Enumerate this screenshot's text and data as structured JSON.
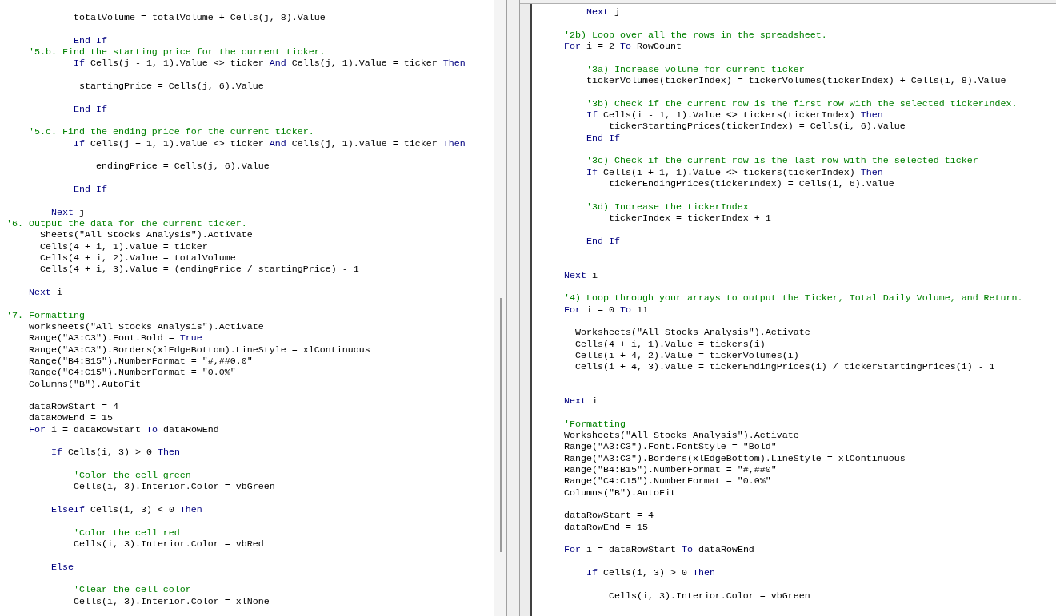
{
  "left_pane": {
    "lines": [
      {
        "tokens": [
          {
            "kind": "plain",
            "text": "            totalVolume = totalVolume + Cells(j, 8).Value"
          }
        ]
      },
      {
        "gap_before": true,
        "tokens": [
          {
            "kind": "keyword",
            "text": "            End If"
          }
        ]
      },
      {
        "tokens": [
          {
            "kind": "comment",
            "text": "    '5.b. Find the starting price for the current ticker."
          }
        ]
      },
      {
        "tokens": [
          {
            "kind": "keyword",
            "text": "            If"
          },
          {
            "kind": "plain",
            "text": " Cells(j - 1, 1).Value <> ticker "
          },
          {
            "kind": "keyword",
            "text": "And"
          },
          {
            "kind": "plain",
            "text": " Cells(j, 1).Value = ticker "
          },
          {
            "kind": "keyword",
            "text": "Then"
          }
        ]
      },
      {
        "gap_before": true,
        "tokens": [
          {
            "kind": "plain",
            "text": "             startingPrice = Cells(j, 6).Value"
          }
        ]
      },
      {
        "gap_before": true,
        "tokens": [
          {
            "kind": "keyword",
            "text": "            End If"
          }
        ]
      },
      {
        "gap_before": true,
        "tokens": [
          {
            "kind": "comment",
            "text": "    '5.c. Find the ending price for the current ticker."
          }
        ]
      },
      {
        "tokens": [
          {
            "kind": "keyword",
            "text": "            If"
          },
          {
            "kind": "plain",
            "text": " Cells(j + 1, 1).Value <> ticker "
          },
          {
            "kind": "keyword",
            "text": "And"
          },
          {
            "kind": "plain",
            "text": " Cells(j, 1).Value = ticker "
          },
          {
            "kind": "keyword",
            "text": "Then"
          }
        ]
      },
      {
        "gap_before": true,
        "tokens": [
          {
            "kind": "plain",
            "text": "                endingPrice = Cells(j, 6).Value"
          }
        ]
      },
      {
        "gap_before": true,
        "tokens": [
          {
            "kind": "keyword",
            "text": "            End If"
          }
        ]
      },
      {
        "gap_before": true,
        "tokens": [
          {
            "kind": "keyword",
            "text": "        Next"
          },
          {
            "kind": "plain",
            "text": " j"
          }
        ]
      },
      {
        "tokens": [
          {
            "kind": "comment",
            "text": "'6. Output the data for the current ticker."
          }
        ]
      },
      {
        "tokens": [
          {
            "kind": "plain",
            "text": "      Sheets(\"All Stocks Analysis\").Activate"
          }
        ]
      },
      {
        "tokens": [
          {
            "kind": "plain",
            "text": "      Cells(4 + i, 1).Value = ticker"
          }
        ]
      },
      {
        "tokens": [
          {
            "kind": "plain",
            "text": "      Cells(4 + i, 2).Value = totalVolume"
          }
        ]
      },
      {
        "tokens": [
          {
            "kind": "plain",
            "text": "      Cells(4 + i, 3).Value = (endingPrice / startingPrice) - 1"
          }
        ]
      },
      {
        "gap_before": true,
        "tokens": [
          {
            "kind": "keyword",
            "text": "    Next"
          },
          {
            "kind": "plain",
            "text": " i"
          }
        ]
      },
      {
        "gap_before": true,
        "tokens": [
          {
            "kind": "comment",
            "text": "'7. Formatting"
          }
        ]
      },
      {
        "tokens": [
          {
            "kind": "plain",
            "text": "    Worksheets(\"All Stocks Analysis\").Activate"
          }
        ]
      },
      {
        "tokens": [
          {
            "kind": "plain",
            "text": "    Range(\"A3:C3\").Font.Bold = "
          },
          {
            "kind": "keyword",
            "text": "True"
          }
        ]
      },
      {
        "tokens": [
          {
            "kind": "plain",
            "text": "    Range(\"A3:C3\").Borders(xlEdgeBottom).LineStyle = xlContinuous"
          }
        ]
      },
      {
        "tokens": [
          {
            "kind": "plain",
            "text": "    Range(\"B4:B15\").NumberFormat = \"#,##0.0\""
          }
        ]
      },
      {
        "tokens": [
          {
            "kind": "plain",
            "text": "    Range(\"C4:C15\").NumberFormat = \"0.0%\""
          }
        ]
      },
      {
        "tokens": [
          {
            "kind": "plain",
            "text": "    Columns(\"B\").AutoFit"
          }
        ]
      },
      {
        "gap_before": true,
        "tokens": [
          {
            "kind": "plain",
            "text": "    dataRowStart = 4"
          }
        ]
      },
      {
        "tokens": [
          {
            "kind": "plain",
            "text": "    dataRowEnd = 15"
          }
        ]
      },
      {
        "tokens": [
          {
            "kind": "keyword",
            "text": "    For"
          },
          {
            "kind": "plain",
            "text": " i = dataRowStart "
          },
          {
            "kind": "keyword",
            "text": "To"
          },
          {
            "kind": "plain",
            "text": " dataRowEnd"
          }
        ]
      },
      {
        "gap_before": true,
        "tokens": [
          {
            "kind": "keyword",
            "text": "        If"
          },
          {
            "kind": "plain",
            "text": " Cells(i, 3) > 0 "
          },
          {
            "kind": "keyword",
            "text": "Then"
          }
        ]
      },
      {
        "gap_before": true,
        "tokens": [
          {
            "kind": "comment",
            "text": "            'Color the cell green"
          }
        ]
      },
      {
        "tokens": [
          {
            "kind": "plain",
            "text": "            Cells(i, 3).Interior.Color = vbGreen"
          }
        ]
      },
      {
        "gap_before": true,
        "tokens": [
          {
            "kind": "keyword",
            "text": "        ElseIf"
          },
          {
            "kind": "plain",
            "text": " Cells(i, 3) < 0 "
          },
          {
            "kind": "keyword",
            "text": "Then"
          }
        ]
      },
      {
        "gap_before": true,
        "tokens": [
          {
            "kind": "comment",
            "text": "            'Color the cell red"
          }
        ]
      },
      {
        "tokens": [
          {
            "kind": "plain",
            "text": "            Cells(i, 3).Interior.Color = vbRed"
          }
        ]
      },
      {
        "gap_before": true,
        "tokens": [
          {
            "kind": "keyword",
            "text": "        Else"
          }
        ]
      },
      {
        "gap_before": true,
        "tokens": [
          {
            "kind": "comment",
            "text": "            'Clear the cell color"
          }
        ]
      },
      {
        "tokens": [
          {
            "kind": "plain",
            "text": "            Cells(i, 3).Interior.Color = xlNone"
          }
        ]
      }
    ]
  },
  "right_pane": {
    "lines": [
      {
        "tokens": [
          {
            "kind": "keyword",
            "text": "    Next"
          },
          {
            "kind": "plain",
            "text": " j"
          }
        ]
      },
      {
        "gap_before": true,
        "tokens": [
          {
            "kind": "comment",
            "text": "'2b) Loop over all the rows in the spreadsheet."
          }
        ]
      },
      {
        "tokens": [
          {
            "kind": "keyword",
            "text": "For"
          },
          {
            "kind": "plain",
            "text": " i = 2 "
          },
          {
            "kind": "keyword",
            "text": "To"
          },
          {
            "kind": "plain",
            "text": " RowCount"
          }
        ]
      },
      {
        "gap_before": true,
        "tokens": [
          {
            "kind": "comment",
            "text": "    '3a) Increase volume for current ticker"
          }
        ]
      },
      {
        "tokens": [
          {
            "kind": "plain",
            "text": "    tickerVolumes(tickerIndex) = tickerVolumes(tickerIndex) + Cells(i, 8).Value"
          }
        ]
      },
      {
        "gap_before": true,
        "tokens": [
          {
            "kind": "comment",
            "text": "    '3b) Check if the current row is the first row with the selected tickerIndex."
          }
        ]
      },
      {
        "tokens": [
          {
            "kind": "keyword",
            "text": "    If"
          },
          {
            "kind": "plain",
            "text": " Cells(i - 1, 1).Value <> tickers(tickerIndex) "
          },
          {
            "kind": "keyword",
            "text": "Then"
          }
        ]
      },
      {
        "tokens": [
          {
            "kind": "plain",
            "text": "        tickerStartingPrices(tickerIndex) = Cells(i, 6).Value"
          }
        ]
      },
      {
        "tokens": [
          {
            "kind": "keyword",
            "text": "    End If"
          }
        ]
      },
      {
        "gap_before": true,
        "tokens": [
          {
            "kind": "comment",
            "text": "    '3c) Check if the current row is the last row with the selected ticker"
          }
        ]
      },
      {
        "tokens": [
          {
            "kind": "keyword",
            "text": "    If"
          },
          {
            "kind": "plain",
            "text": " Cells(i + 1, 1).Value <> tickers(tickerIndex) "
          },
          {
            "kind": "keyword",
            "text": "Then"
          }
        ]
      },
      {
        "tokens": [
          {
            "kind": "plain",
            "text": "        tickerEndingPrices(tickerIndex) = Cells(i, 6).Value"
          }
        ]
      },
      {
        "gap_before": true,
        "tokens": [
          {
            "kind": "comment",
            "text": "    '3d) Increase the tickerIndex"
          }
        ]
      },
      {
        "tokens": [
          {
            "kind": "plain",
            "text": "        tickerIndex = tickerIndex + 1"
          }
        ]
      },
      {
        "gap_before": true,
        "tokens": [
          {
            "kind": "keyword",
            "text": "    End If"
          }
        ]
      },
      {
        "gap_before": true,
        "double_gap": true,
        "tokens": [
          {
            "kind": "keyword",
            "text": "Next"
          },
          {
            "kind": "plain",
            "text": " i"
          }
        ]
      },
      {
        "gap_before": true,
        "tokens": [
          {
            "kind": "comment",
            "text": "'4) Loop through your arrays to output the Ticker, Total Daily Volume, and Return."
          }
        ]
      },
      {
        "tokens": [
          {
            "kind": "keyword",
            "text": "For"
          },
          {
            "kind": "plain",
            "text": " i = 0 "
          },
          {
            "kind": "keyword",
            "text": "To"
          },
          {
            "kind": "plain",
            "text": " 11"
          }
        ]
      },
      {
        "gap_before": true,
        "tokens": [
          {
            "kind": "plain",
            "text": "  Worksheets(\"All Stocks Analysis\").Activate"
          }
        ]
      },
      {
        "tokens": [
          {
            "kind": "plain",
            "text": "  Cells(4 + i, 1).Value = tickers(i)"
          }
        ]
      },
      {
        "tokens": [
          {
            "kind": "plain",
            "text": "  Cells(i + 4, 2).Value = tickerVolumes(i)"
          }
        ]
      },
      {
        "tokens": [
          {
            "kind": "plain",
            "text": "  Cells(i + 4, 3).Value = tickerEndingPrices(i) / tickerStartingPrices(i) - 1"
          }
        ]
      },
      {
        "gap_before": true,
        "double_gap": true,
        "tokens": [
          {
            "kind": "keyword",
            "text": "Next"
          },
          {
            "kind": "plain",
            "text": " i"
          }
        ]
      },
      {
        "gap_before": true,
        "tokens": [
          {
            "kind": "comment",
            "text": "'Formatting"
          }
        ]
      },
      {
        "tokens": [
          {
            "kind": "plain",
            "text": "Worksheets(\"All Stocks Analysis\").Activate"
          }
        ]
      },
      {
        "tokens": [
          {
            "kind": "plain",
            "text": "Range(\"A3:C3\").Font.FontStyle = \"Bold\""
          }
        ]
      },
      {
        "tokens": [
          {
            "kind": "plain",
            "text": "Range(\"A3:C3\").Borders(xlEdgeBottom).LineStyle = xlContinuous"
          }
        ]
      },
      {
        "tokens": [
          {
            "kind": "plain",
            "text": "Range(\"B4:B15\").NumberFormat = \"#,##0\""
          }
        ]
      },
      {
        "tokens": [
          {
            "kind": "plain",
            "text": "Range(\"C4:C15\").NumberFormat = \"0.0%\""
          }
        ]
      },
      {
        "tokens": [
          {
            "kind": "plain",
            "text": "Columns(\"B\").AutoFit"
          }
        ]
      },
      {
        "gap_before": true,
        "tokens": [
          {
            "kind": "plain",
            "text": "dataRowStart = 4"
          }
        ]
      },
      {
        "tokens": [
          {
            "kind": "plain",
            "text": "dataRowEnd = 15"
          }
        ]
      },
      {
        "gap_before": true,
        "tokens": [
          {
            "kind": "keyword",
            "text": "For"
          },
          {
            "kind": "plain",
            "text": " i = dataRowStart "
          },
          {
            "kind": "keyword",
            "text": "To"
          },
          {
            "kind": "plain",
            "text": " dataRowEnd"
          }
        ]
      },
      {
        "gap_before": true,
        "tokens": [
          {
            "kind": "keyword",
            "text": "    If"
          },
          {
            "kind": "plain",
            "text": " Cells(i, 3) > 0 "
          },
          {
            "kind": "keyword",
            "text": "Then"
          }
        ]
      },
      {
        "gap_before": true,
        "tokens": [
          {
            "kind": "plain",
            "text": "        Cells(i, 3).Interior.Color = vbGreen"
          }
        ]
      }
    ]
  }
}
